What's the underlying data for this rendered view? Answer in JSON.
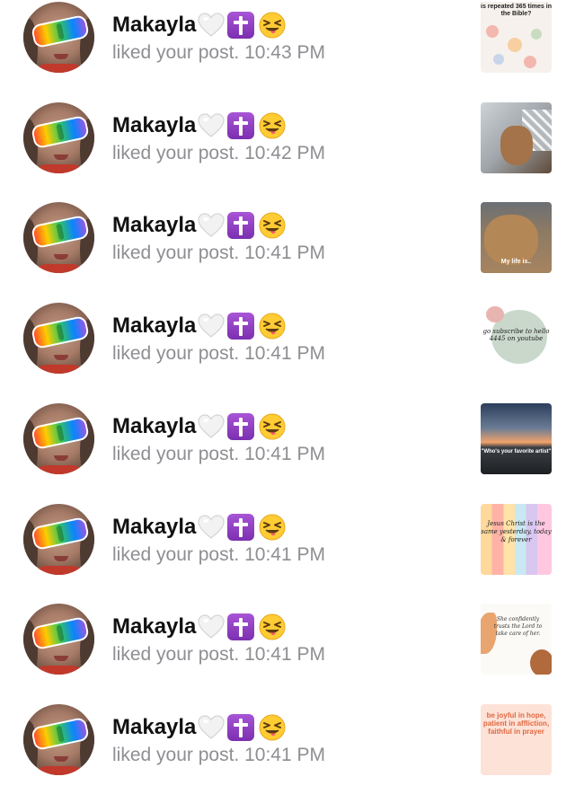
{
  "notifications": [
    {
      "user": "Makayla",
      "action": "liked your post.",
      "time": "10:43 PM",
      "thumb_style": "t1",
      "thumb_caption": "is repeated 365 times in the Bible?"
    },
    {
      "user": "Makayla",
      "action": "liked your post.",
      "time": "10:42 PM",
      "thumb_style": "t2",
      "thumb_caption": ""
    },
    {
      "user": "Makayla",
      "action": "liked your post.",
      "time": "10:41 PM",
      "thumb_style": "t3",
      "thumb_caption": "My life is.."
    },
    {
      "user": "Makayla",
      "action": "liked your post.",
      "time": "10:41 PM",
      "thumb_style": "t4",
      "thumb_caption": "go subscribe to hello 4445 on youtube"
    },
    {
      "user": "Makayla",
      "action": "liked your post.",
      "time": "10:41 PM",
      "thumb_style": "t5",
      "thumb_caption": "\"Who's your favorite artist\""
    },
    {
      "user": "Makayla",
      "action": "liked your post.",
      "time": "10:41 PM",
      "thumb_style": "t6",
      "thumb_caption": "Jesus Christ is the same yesterday, today & forever"
    },
    {
      "user": "Makayla",
      "action": "liked your post.",
      "time": "10:41 PM",
      "thumb_style": "t7",
      "thumb_caption": "She confidently trusts the Lord to take care of her."
    },
    {
      "user": "Makayla",
      "action": "liked your post.",
      "time": "10:41 PM",
      "thumb_style": "t8",
      "thumb_caption": "be joyful in hope, patient in affliction, faithful in prayer"
    }
  ],
  "icons": {
    "heart": "white-heart-icon",
    "cross": "latin-cross-icon",
    "face": "squinting-tongue-face-icon"
  },
  "colors": {
    "name": "#111111",
    "secondary_text": "#8e8e93",
    "background": "#ffffff"
  }
}
